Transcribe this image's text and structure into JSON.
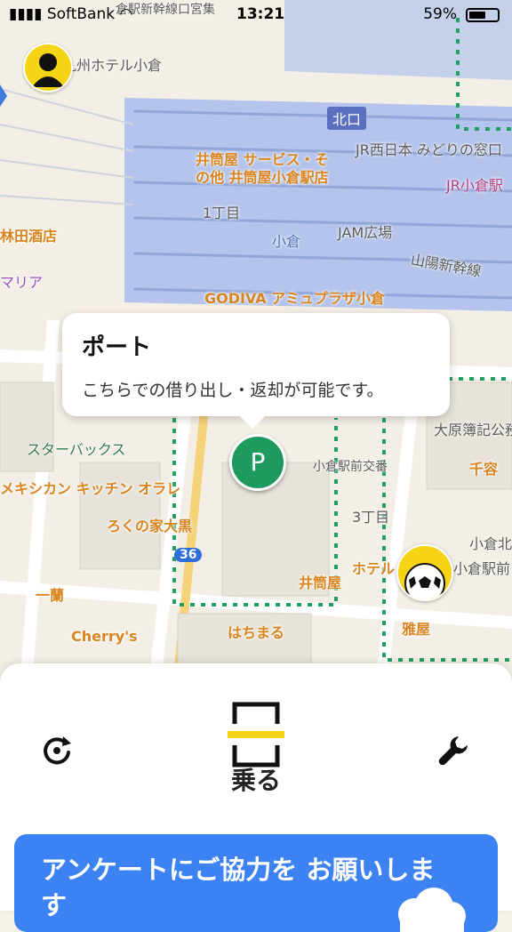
{
  "status_bar": {
    "carrier": "SoftBank",
    "time": "13:21",
    "battery_percent": "59%",
    "battery_level": 0.59
  },
  "map": {
    "labels": {
      "hotel": "九州ホテル小倉",
      "north_exit": "北口",
      "jr_midori": "JR西日本 みどりの窓口",
      "jr_kokura": "JR小倉駅",
      "izutsuya_service": "井筒屋 サービス・そ\nの他 井筒屋小倉駅店",
      "chome1": "1丁目",
      "kokura": "小倉",
      "jam": "JAM広場",
      "sanyo": "山陽新幹線",
      "sake": "林田酒店",
      "maria": "マリア",
      "godiva": "GODIVA アミュプラザ小倉",
      "starbucks": "スターバックス",
      "mexican": "メキシカン キッチン オラレ",
      "rokunoie": "ろくの家大黒",
      "ichiran": "一蘭",
      "cherry": "Cherry's",
      "hachimaru": "はちまる",
      "izutsuya": "井筒屋",
      "crossing": "小倉駅前交番",
      "chome3": "3丁目",
      "ohara": "大原簿記公務",
      "sengyo": "千容",
      "hotel2": "ホテル",
      "kokura_station_front": "小倉駅前",
      "miyabi": "雅屋",
      "kokura_kita": "小倉北",
      "route_36": "36",
      "station_top": "倉駅新幹線口宮集"
    },
    "route_line_color": "#20a060",
    "parking_pin_label": "P"
  },
  "tooltip": {
    "title": "ポート",
    "description": "こちらでの借り出し・返却が可能です。"
  },
  "bottom_sheet": {
    "primary_action": "乗る",
    "survey_text": "アンケートにご協力を お願いします"
  },
  "icons": {
    "user_avatar": "person-avatar-icon",
    "reload": "reload-icon",
    "scan": "qr-scan-icon",
    "settings": "wrench-icon"
  },
  "colors": {
    "accent_yellow": "#f5d415",
    "port_green": "#1d9a5e",
    "survey_blue": "#3d82f2",
    "station_blue": "#a8bdf0"
  }
}
